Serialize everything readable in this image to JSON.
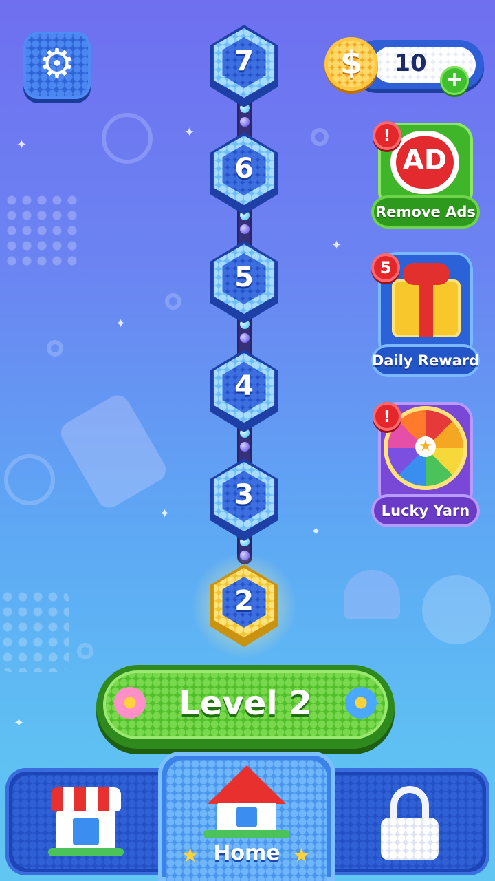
{
  "top_bar": {
    "settings_icon": "gear-icon",
    "coins": "10",
    "coin_symbol": "$",
    "plus_label": "+"
  },
  "levels": [
    {
      "number": "7",
      "state": "locked"
    },
    {
      "number": "6",
      "state": "locked"
    },
    {
      "number": "5",
      "state": "locked"
    },
    {
      "number": "4",
      "state": "locked"
    },
    {
      "number": "3",
      "state": "locked"
    },
    {
      "number": "2",
      "state": "current"
    }
  ],
  "side_features": {
    "remove_ads": {
      "icon_text": "AD",
      "label": "Remove Ads",
      "badge": "!"
    },
    "daily_reward": {
      "label": "Daily Reward",
      "badge": "5"
    },
    "lucky_yarn": {
      "label": "Lucky Yarn",
      "badge": "!"
    }
  },
  "play_button": {
    "label": "Level 2"
  },
  "bottom_nav": {
    "shop_icon": "shop-icon",
    "home_label": "Home",
    "lock_icon": "lock-icon"
  },
  "colors": {
    "accent_green": "#4fbf2a",
    "accent_blue": "#2e63d8",
    "accent_gold": "#f3c431",
    "badge_red": "#e5262b"
  }
}
